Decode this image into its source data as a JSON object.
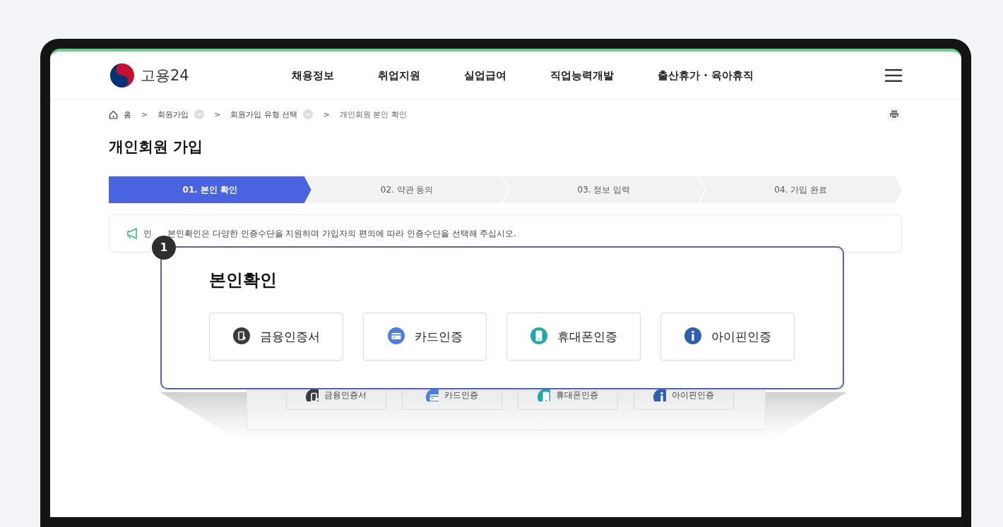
{
  "header": {
    "logo_text": "고용24",
    "nav": [
      "채용정보",
      "취업지원",
      "실업급여",
      "직업능력개발",
      "출산휴가 · 육아휴직"
    ]
  },
  "breadcrumb_separator": ">",
  "breadcrumb": [
    {
      "label": "홈",
      "kind": "home"
    },
    {
      "label": "회원가입",
      "kind": "dropdown"
    },
    {
      "label": "회원가입 유형 선택",
      "kind": "dropdown"
    },
    {
      "label": "개인회원 본인 확인",
      "kind": "current"
    }
  ],
  "page_title": "개인회원 가입",
  "steps": [
    {
      "label": "01. 본인 확인",
      "selected": true
    },
    {
      "label": "02. 약관 동의",
      "selected": false
    },
    {
      "label": "03. 정보 입력",
      "selected": false
    },
    {
      "label": "04. 가입 완료",
      "selected": false
    }
  ],
  "notice": {
    "label": "인",
    "text": "본인확인은 다양한 인증수단을 지원하며 가입자의 편의에 따라 인증수단을 선택해 주십시오."
  },
  "background_methods": [
    {
      "label": "금융인증서",
      "kind": "certificate"
    },
    {
      "label": "카드인증",
      "kind": "card"
    },
    {
      "label": "휴대폰인증",
      "kind": "phone"
    },
    {
      "label": "아이핀인증",
      "kind": "ipin"
    }
  ],
  "callout": {
    "number": "1",
    "title": "본인확인",
    "methods": [
      {
        "label": "금융인증서",
        "kind": "certificate"
      },
      {
        "label": "카드인증",
        "kind": "card"
      },
      {
        "label": "휴대폰인증",
        "kind": "phone"
      },
      {
        "label": "아이핀인증",
        "kind": "ipin"
      }
    ]
  }
}
